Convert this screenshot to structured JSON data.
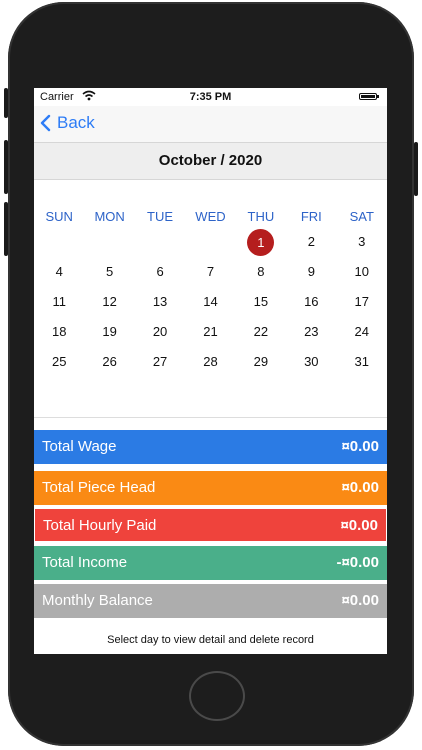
{
  "status": {
    "carrier": "Carrier",
    "time": "7:35 PM"
  },
  "nav": {
    "back_label": "Back"
  },
  "calendar": {
    "month_title": "October / 2020",
    "weekdays": [
      "SUN",
      "MON",
      "TUE",
      "WED",
      "THU",
      "FRI",
      "SAT"
    ],
    "weeks": [
      [
        "",
        "",
        "",
        "",
        "1",
        "2",
        "3"
      ],
      [
        "4",
        "5",
        "6",
        "7",
        "8",
        "9",
        "10"
      ],
      [
        "11",
        "12",
        "13",
        "14",
        "15",
        "16",
        "17"
      ],
      [
        "18",
        "19",
        "20",
        "21",
        "22",
        "23",
        "24"
      ],
      [
        "25",
        "26",
        "27",
        "28",
        "29",
        "30",
        "31"
      ]
    ],
    "selected_day": "1"
  },
  "summary": [
    {
      "label": "Total Wage",
      "amount": "¤0.00",
      "color": "#2b7be4"
    },
    {
      "label": "Total Piece Head",
      "amount": "¤0.00",
      "color": "#fa8a14"
    },
    {
      "label": "Total Hourly Paid",
      "amount": "¤0.00",
      "color": "#ef433c"
    },
    {
      "label": "Total Income",
      "amount": "-¤0.00",
      "color": "#4aaf8a"
    },
    {
      "label": "Monthly Balance",
      "amount": "¤0.00",
      "color": "#adadad"
    }
  ],
  "footer_text": "Select day to view detail and delete record"
}
